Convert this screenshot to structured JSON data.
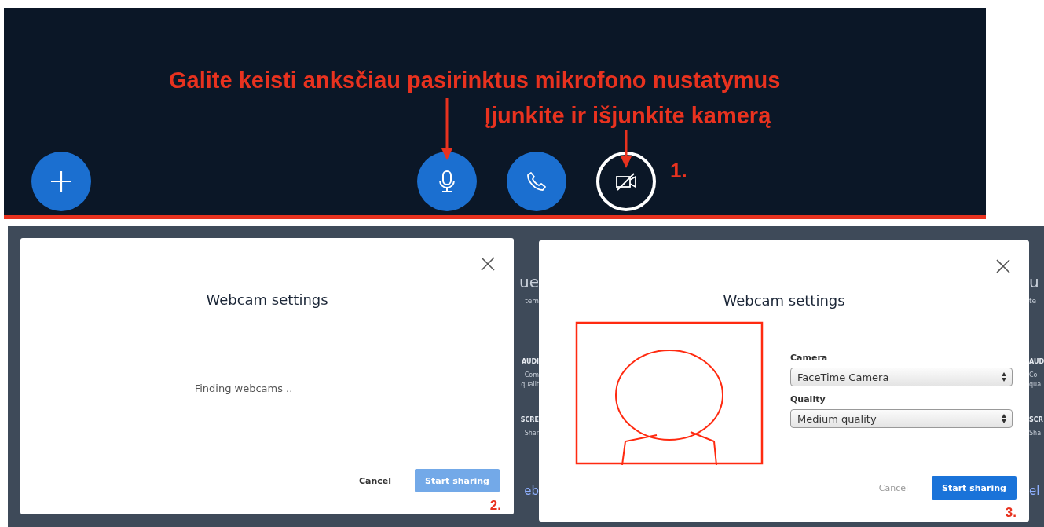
{
  "toolbar": {
    "captions": [
      "Galite keisti anksčiau pasirinktus mikrofono nustatymus",
      "Įjunkite ir išjunkite kamerą"
    ],
    "buttons": [
      {
        "kind": "add"
      },
      {
        "kind": "microphone"
      },
      {
        "kind": "phone"
      },
      {
        "kind": "camera"
      }
    ],
    "step": "1."
  },
  "panels": [
    {
      "dialog": {
        "title": "Webcam settings",
        "message": "Finding webcams ..",
        "buttons": [
          {
            "label": "Cancel",
            "kind": "link",
            "disabled": false
          },
          {
            "label": "Start sharing",
            "kind": "primary",
            "disabled": true
          }
        ],
        "step": "2."
      },
      "fragments": [
        {
          "text": "ue",
          "kind": "heading"
        },
        {
          "text": "tem",
          "kind": "sub"
        },
        {
          "text": "AUDI",
          "kind": "label"
        },
        {
          "text": "Com",
          "kind": "text"
        },
        {
          "text": "qualit",
          "kind": "text"
        },
        {
          "text": "SCRE",
          "kind": "label"
        },
        {
          "text": "Shar",
          "kind": "text"
        },
        {
          "text": "eb",
          "kind": "link"
        }
      ]
    },
    {
      "dialog": {
        "title": "Webcam settings",
        "fields": [
          {
            "label": "Camera",
            "value": "FaceTime Camera"
          },
          {
            "label": "Quality",
            "value": "Medium quality"
          }
        ],
        "buttons": [
          {
            "label": "Cancel",
            "kind": "link",
            "disabled": true
          },
          {
            "label": "Start sharing",
            "kind": "primary",
            "disabled": false
          }
        ],
        "step": "3."
      },
      "fragments": [
        {
          "text": "u",
          "kind": "heading"
        },
        {
          "text": "te",
          "kind": "sub"
        },
        {
          "text": "AUD",
          "kind": "label"
        },
        {
          "text": "Co",
          "kind": "text"
        },
        {
          "text": "qua",
          "kind": "text"
        },
        {
          "text": "SCR",
          "kind": "label"
        },
        {
          "text": "Sha",
          "kind": "text"
        },
        {
          "text": "el",
          "kind": "link"
        }
      ]
    }
  ]
}
